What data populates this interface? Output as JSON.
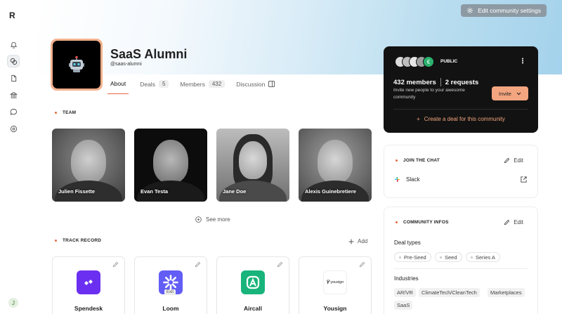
{
  "app": {
    "logo": "R",
    "user_initial": "J"
  },
  "header": {
    "edit_settings_label": "Edit community settings",
    "title": "SaaS Alumni",
    "handle": "@saas-alumni"
  },
  "tabs": [
    {
      "label": "About",
      "count": ""
    },
    {
      "label": "Deals",
      "count": "5"
    },
    {
      "label": "Members",
      "count": "432"
    },
    {
      "label": "Discussion",
      "count": ""
    }
  ],
  "team": {
    "section_label": "TEAM",
    "members": [
      {
        "name": "Julien Fissette"
      },
      {
        "name": "Evan Testa"
      },
      {
        "name": "Jane Doe"
      },
      {
        "name": "Alexis Guinebretiere"
      }
    ],
    "see_more_label": "See more"
  },
  "track_record": {
    "section_label": "TRACK RECORD",
    "add_label": "Add",
    "deals": [
      {
        "name": "Spendesk",
        "badge": ""
      },
      {
        "name": "Loom",
        "badge": "Exit"
      },
      {
        "name": "Aircall",
        "badge": ""
      },
      {
        "name": "Yousign",
        "badge": "yousign"
      }
    ]
  },
  "community_card": {
    "visibility": "PUBLIC",
    "avatar_initial": "€",
    "members_count": "432 members",
    "requests_count": "2 requests",
    "invite_text": "Invite new people to your awesome community",
    "invite_button": "Invite",
    "create_deal_label": "Create a deal for this community"
  },
  "chat": {
    "section_label": "JOIN THE CHAT",
    "edit_label": "Edit",
    "channel": "Slack"
  },
  "infos": {
    "section_label": "COMMUNITY INFOS",
    "edit_label": "Edit",
    "deal_types_label": "Deal types",
    "deal_types": [
      "Pre-Seed",
      "Seed",
      "Series A"
    ],
    "industries_label": "Industries",
    "industries": [
      "AR/VR",
      "ClimateTech/CleanTech",
      "Marketplaces",
      "SaaS"
    ]
  },
  "colors": {
    "accent": "#e36a40",
    "invite_button": "#f3a57f",
    "dark_card": "#121212",
    "spendesk": "#6a2ff0",
    "loom": "#625df5",
    "aircall": "#18b47b"
  }
}
